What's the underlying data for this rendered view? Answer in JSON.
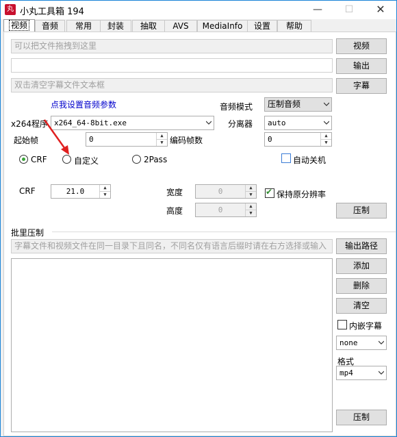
{
  "window": {
    "title": "小丸工具箱 194",
    "icon_text": "丸"
  },
  "tabs": [
    "视频",
    "音频",
    "常用",
    "封装",
    "抽取",
    "AVS",
    "MediaInfo",
    "设置",
    "帮助"
  ],
  "video": {
    "video_input_placeholder": "可以把文件拖拽到这里",
    "output_value": "",
    "subtitle_placeholder": "双击清空字幕文件文本框",
    "video_button": "视频",
    "output_button": "输出",
    "subtitle_button": "字幕",
    "audio_settings_link": "点我设置音频参数",
    "audio_mode_label": "音频模式",
    "audio_mode_value": "压制音频",
    "x264_label": "x264程序",
    "x264_value": "x264_64-8bit.exe",
    "splitter_label": "分离器",
    "splitter_value": "auto",
    "start_frame_label": "起始帧",
    "start_frame_value": "0",
    "encode_frames_label": "编码帧数",
    "encode_frames_value": "0",
    "mode_crf": "CRF",
    "mode_custom": "自定义",
    "mode_2pass": "2Pass",
    "auto_shutdown": "自动关机",
    "crf_label": "CRF",
    "crf_value": "21.0",
    "width_label": "宽度",
    "width_value": "0",
    "height_label": "高度",
    "height_value": "0",
    "keep_resolution": "保持原分辨率",
    "encode_button": "压制"
  },
  "batch": {
    "group_title": "批里压制",
    "hint": "字幕文件和视频文件在同一目录下且同名，不同名仅有语言后缀时请在右方选择或输入",
    "output_path_button": "输出路径",
    "add_button": "添加",
    "delete_button": "删除",
    "clear_button": "清空",
    "embed_subtitle": "内嵌字幕",
    "subtitle_lang_value": "none",
    "format_label": "格式",
    "format_value": "mp4",
    "encode_button": "压制"
  }
}
